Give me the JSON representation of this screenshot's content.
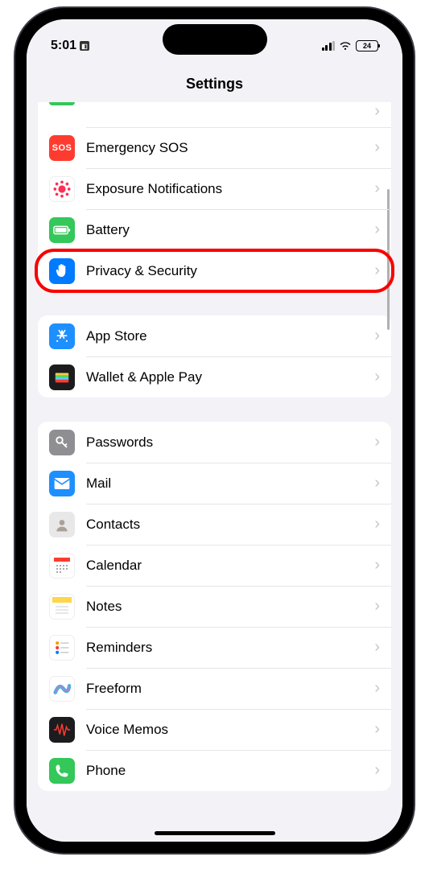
{
  "status": {
    "time": "5:01",
    "battery_pct": "24"
  },
  "title": "Settings",
  "groups": [
    {
      "id": "system",
      "rows": [
        {
          "key": "partial-top",
          "label": ""
        },
        {
          "key": "emergency-sos",
          "label": "Emergency SOS"
        },
        {
          "key": "exposure-notifications",
          "label": "Exposure Notifications"
        },
        {
          "key": "battery",
          "label": "Battery"
        },
        {
          "key": "privacy-security",
          "label": "Privacy & Security",
          "highlight": true
        }
      ]
    },
    {
      "id": "store",
      "rows": [
        {
          "key": "app-store",
          "label": "App Store"
        },
        {
          "key": "wallet-apple-pay",
          "label": "Wallet & Apple Pay"
        }
      ]
    },
    {
      "id": "apps",
      "rows": [
        {
          "key": "passwords",
          "label": "Passwords"
        },
        {
          "key": "mail",
          "label": "Mail"
        },
        {
          "key": "contacts",
          "label": "Contacts"
        },
        {
          "key": "calendar",
          "label": "Calendar"
        },
        {
          "key": "notes",
          "label": "Notes"
        },
        {
          "key": "reminders",
          "label": "Reminders"
        },
        {
          "key": "freeform",
          "label": "Freeform"
        },
        {
          "key": "voice-memos",
          "label": "Voice Memos"
        },
        {
          "key": "phone",
          "label": "Phone"
        }
      ]
    }
  ]
}
